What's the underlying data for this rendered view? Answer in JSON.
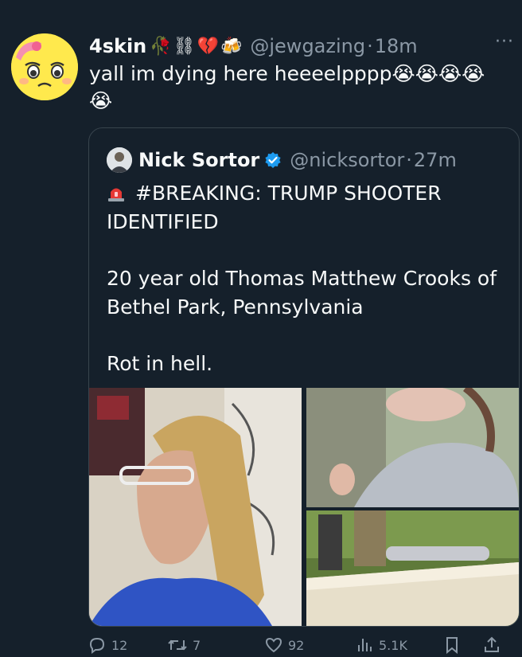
{
  "tweet": {
    "display_name": "4skin",
    "name_emojis": "🥀⛓💔🍻",
    "handle": "@jewgazing",
    "separator": "·",
    "time": "18m",
    "more": "···",
    "text": "yall im dying here heeeelpppp😭😭😭😭😭"
  },
  "quote": {
    "display_name": "Nick Sortor",
    "handle": "@nicksortor",
    "separator": "·",
    "time": "27m",
    "line1": "#BREAKING: TRUMP SHOOTER IDENTIFIED",
    "line2": "20 year old Thomas Matthew Crooks of Bethel Park, Pennsylvania",
    "line3": "Rot in hell."
  },
  "actions": {
    "replies": "12",
    "reposts": "7",
    "likes": "92",
    "views": "5.1K"
  },
  "colors": {
    "background": "#15202b",
    "muted": "#8b98a5",
    "border": "#38444d",
    "verified": "#1d9bf0"
  }
}
